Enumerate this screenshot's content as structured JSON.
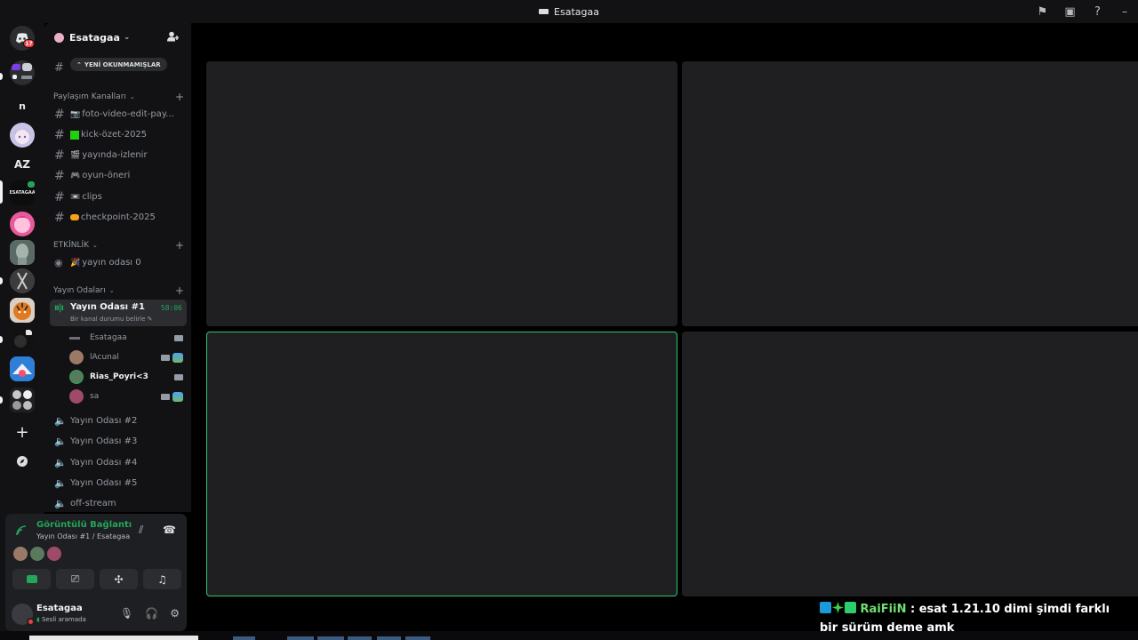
{
  "window": {
    "title": "Esatagaa",
    "controls": [
      "flag-icon",
      "inbox-icon",
      "help-icon",
      "minimize-icon"
    ]
  },
  "servers": [
    {
      "id": "home",
      "label": "",
      "badge": "17",
      "color": "#5865f2"
    },
    {
      "id": "srv2",
      "label": "",
      "color": "#2b2d31"
    },
    {
      "id": "srv3",
      "label": "n",
      "color": "#121214"
    },
    {
      "id": "srv4",
      "label": "",
      "color": "#c9c4e6"
    },
    {
      "id": "srv5",
      "label": "AZ",
      "color": "#121214"
    },
    {
      "id": "srv6",
      "label": "ESATAGAA",
      "color": "#0d0d0d"
    },
    {
      "id": "srv7",
      "label": "",
      "color": "#e85a9b"
    },
    {
      "id": "srv8",
      "label": "",
      "color": "#6b7a72"
    },
    {
      "id": "srv9",
      "label": "",
      "color": "#4a4a4a"
    },
    {
      "id": "srv10",
      "label": "",
      "color": "#c4742a"
    },
    {
      "id": "srv11",
      "label": "",
      "color": "#1c1c1c"
    },
    {
      "id": "srv12",
      "label": "",
      "color": "#3a8ee6"
    },
    {
      "id": "srv13",
      "label": "",
      "color": "#8a8a8a"
    }
  ],
  "rail_actions": {
    "add": "+",
    "discover": "compass"
  },
  "guild": {
    "name": "Esatagaa",
    "unread_pill": "YENİ OKUNMAMIŞLAR"
  },
  "categories": {
    "paylasim": "Paylaşım Kanalları",
    "etkinlik": "ETKİNLİK",
    "yayin": "Yayın Odaları"
  },
  "text_channels": [
    {
      "emoji": "📷",
      "name": "foto-video-edit-pay..."
    },
    {
      "emoji": "",
      "name": "kick-özet-2025"
    },
    {
      "emoji": "🎬",
      "name": "yayında-izlenir"
    },
    {
      "emoji": "🎮",
      "name": "oyun-öneri"
    },
    {
      "emoji": "📼",
      "name": "clips"
    },
    {
      "emoji": "",
      "name": "checkpoint-2025"
    }
  ],
  "event_channel": {
    "emoji": "🎉",
    "name": "yayın odası 0"
  },
  "active_voice": {
    "name": "Yayın Odası #1",
    "timer": "58:06",
    "status": "Bir kanal durumu belirle"
  },
  "voice_users": [
    {
      "name": "Esatagaa",
      "bold": false,
      "camera": true,
      "live": false,
      "avatar": "#4a4d52"
    },
    {
      "name": "lAcunal",
      "bold": false,
      "camera": true,
      "live": true,
      "avatar": "#9a7a66"
    },
    {
      "name": "Rias_Poyri<3",
      "bold": true,
      "camera": true,
      "live": false,
      "avatar": "#5a7a5e"
    },
    {
      "name": "sa",
      "bold": false,
      "camera": true,
      "live": true,
      "avatar": "#a04a6a"
    }
  ],
  "voice_channels": [
    {
      "name": "Yayın Odası #2"
    },
    {
      "name": "Yayın Odası #3"
    },
    {
      "name": "Yayın Odası #4"
    },
    {
      "name": "Yayın Odası #5"
    },
    {
      "name": "off-stream"
    }
  ],
  "voice_panel": {
    "title": "Görüntülü Bağlantı Kur",
    "subtitle": "Yayın Odası #1 / Esatagaa",
    "avatars": [
      "#9a7a66",
      "#5a7a5e",
      "#a04a6a"
    ]
  },
  "user_panel": {
    "name": "Esatagaa",
    "status": "Sesli aramada"
  },
  "stage": {
    "tiles": 4,
    "speaking_tile": 3,
    "accent": "#2dc770"
  },
  "chat_overlay": {
    "username": "RaiFiiN",
    "separator": ":",
    "message": "esat 1.21.10 dimi şimdi farklı bir sürüm deme amk"
  },
  "colors": {
    "background": "#000000",
    "sidebar": "#121214",
    "tile": "#1f1f21",
    "online_green": "#23a55a",
    "danger_red": "#f23f43"
  }
}
